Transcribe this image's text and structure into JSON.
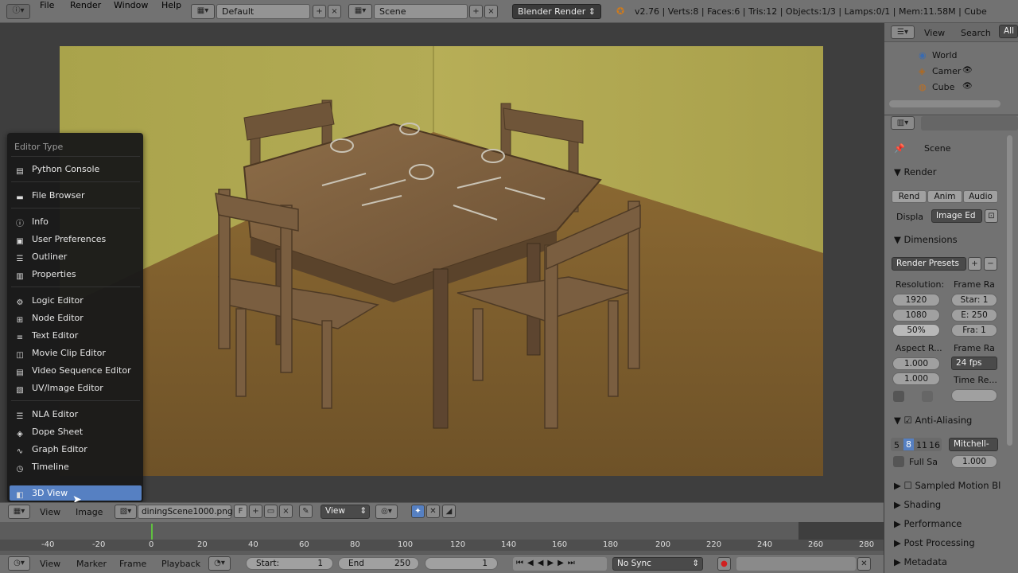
{
  "topbar": {
    "menus": [
      "File",
      "Render",
      "Window",
      "Help"
    ],
    "layout": "Default",
    "scene": "Scene",
    "engine": "Blender Render",
    "stats": "v2.76 | Verts:8 | Faces:6 | Tris:12 | Objects:1/3 | Lamps:0/1 | Mem:11.58M | Cube"
  },
  "outliner": {
    "tabs": [
      "View",
      "Search",
      "All"
    ],
    "items": [
      "World",
      "Camer",
      "Cube"
    ]
  },
  "properties": {
    "breadcrumb": "Scene",
    "render_section": "Render",
    "render_buttons": [
      "Rend",
      "Anim",
      "Audio"
    ],
    "display_label": "Displa",
    "display_value": "Image Ed",
    "dimensions_section": "Dimensions",
    "render_presets": "Render Presets",
    "resolution_label": "Resolution:",
    "frame_range_label": "Frame Ra",
    "res_x": "1920",
    "res_y": "1080",
    "res_pct": "50%",
    "start": "Star: 1",
    "end": "E: 250",
    "frame_step": "Fra: 1",
    "aspect_label": "Aspect R...",
    "frame_rate_label": "Frame Ra",
    "aspect_x": "1.000",
    "aspect_y": "1.000",
    "fps": "24 fps",
    "time_remap_label": "Time Re...",
    "aa_section": "Anti-Aliasing",
    "aa_samples": [
      "5",
      "8",
      "11",
      "16"
    ],
    "aa_filter": "Mitchell-",
    "full_sample": "Full Sa",
    "filter_size": "1.000",
    "motion_blur": "Sampled Motion Bl",
    "shading": "Shading",
    "performance": "Performance",
    "post_processing": "Post Processing",
    "metadata": "Metadata"
  },
  "editor_menu": {
    "title": "Editor Type",
    "groups": [
      [
        "Python Console"
      ],
      [
        "File Browser"
      ],
      [
        "Info",
        "User Preferences",
        "Outliner",
        "Properties"
      ],
      [
        "Logic Editor",
        "Node Editor",
        "Text Editor",
        "Movie Clip Editor",
        "Video Sequence Editor",
        "UV/Image Editor"
      ],
      [
        "NLA Editor",
        "Dope Sheet",
        "Graph Editor",
        "Timeline"
      ]
    ],
    "selected": "3D View"
  },
  "image_header": {
    "view": "View",
    "image": "Image",
    "filename": "diningScene1000.png",
    "f_btn": "F",
    "view_dropdown": "View"
  },
  "timeline": {
    "ticks": [
      "-40",
      "-20",
      "0",
      "20",
      "40",
      "60",
      "80",
      "100",
      "120",
      "140",
      "160",
      "180",
      "200",
      "220",
      "240",
      "260",
      "280"
    ],
    "menus": [
      "View",
      "Marker",
      "Frame",
      "Playback"
    ],
    "start_label": "Start:",
    "start_value": "1",
    "end_label": "End",
    "end_value": "250",
    "current": "1",
    "sync": "No Sync"
  }
}
